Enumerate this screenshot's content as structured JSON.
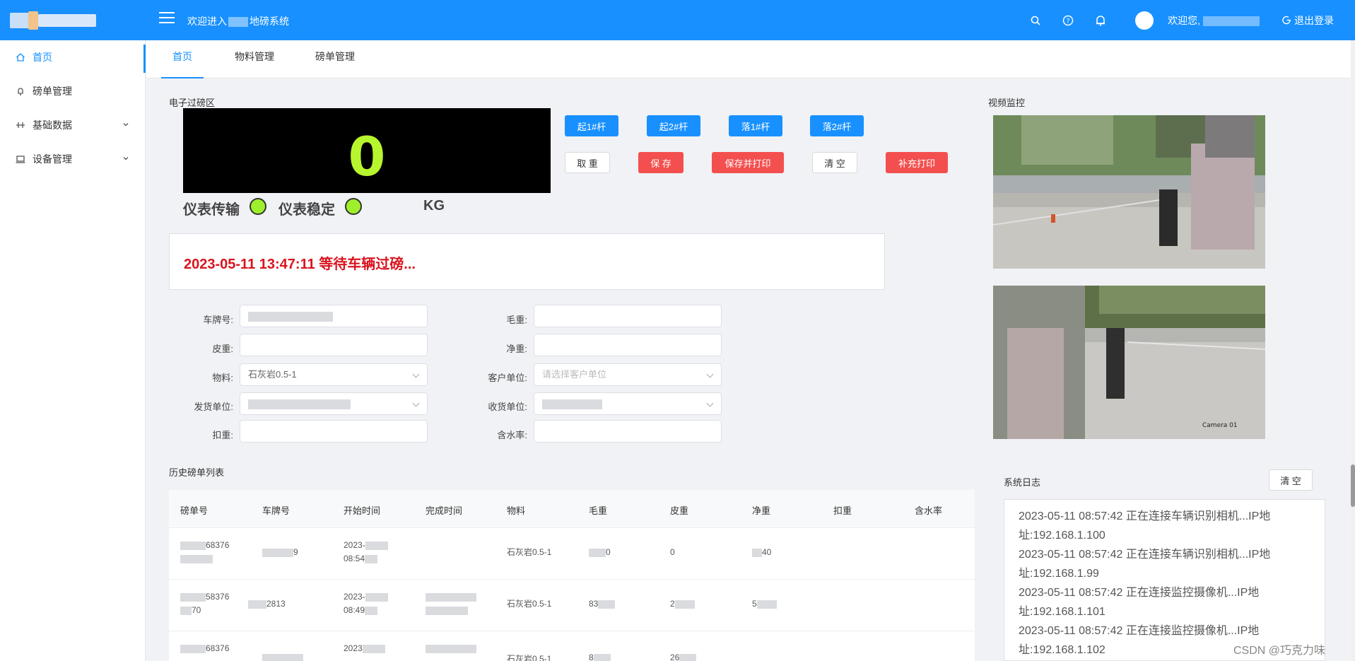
{
  "header": {
    "title_prefix": "欢迎进入",
    "title_suffix": "地磅系统",
    "welcome": "欢迎您,",
    "logout": "退出登录"
  },
  "sidebar": {
    "items": [
      {
        "label": "首页",
        "icon": "home-icon"
      },
      {
        "label": "磅单管理",
        "icon": "bell-icon"
      },
      {
        "label": "基础数据",
        "icon": "sliders-icon"
      },
      {
        "label": "设备管理",
        "icon": "laptop-icon"
      }
    ]
  },
  "tabs": [
    "首页",
    "物料管理",
    "磅单管理"
  ],
  "scale": {
    "section_title": "电子过磅区",
    "weight": "0",
    "indicator1": "仪表传输",
    "indicator2": "仪表稳定",
    "unit": "KG"
  },
  "buttons": {
    "raise1": "起1#杆",
    "raise2": "起2#杆",
    "lower1": "落1#杆",
    "lower2": "落2#杆",
    "cancel": "取 重",
    "save": "保 存",
    "save_print": "保存并打印",
    "clear": "清 空",
    "reprint": "补充打印"
  },
  "status": "2023-05-11 13:47:11 等待车辆过磅...",
  "form": {
    "plate": "车牌号:",
    "gross": "毛重:",
    "tare": "皮重:",
    "net": "净重:",
    "material": "物料:",
    "material_value": "石灰岩0.5-1",
    "customer": "客户单位:",
    "customer_placeholder": "请选择客户单位",
    "shipper": "发货单位:",
    "receiver": "收货单位:",
    "deduct": "扣重:",
    "moisture": "含水率:"
  },
  "history": {
    "title": "历史磅单列表",
    "columns": [
      "磅单号",
      "车牌号",
      "开始时间",
      "完成时间",
      "物料",
      "毛重",
      "皮重",
      "净重",
      "扣重",
      "含水率"
    ],
    "rows": [
      {
        "no": "68376",
        "plate": "9",
        "start_a": "2023-",
        "start_b": "08:54",
        "material": "石灰岩0.5-1",
        "gross": "0",
        "tare": "0",
        "net": "40"
      },
      {
        "no": "58376",
        "no2": "70",
        "plate": "2813",
        "start_a": "2023-",
        "start_b": "08:49",
        "material": "石灰岩0.5-1",
        "gross": "83",
        "tare": "2",
        "net": "5"
      },
      {
        "no": "68376",
        "start_a": "2023",
        "material": "石灰岩0.5-1",
        "gross": "8",
        "tare": "26"
      }
    ]
  },
  "video": {
    "title": "视频监控",
    "cam2_caption": "Camera 01"
  },
  "log": {
    "title": "系统日志",
    "clear": "清 空",
    "lines": [
      "2023-05-11 08:57:42 正在连接车辆识别相机...IP地",
      "址:192.168.1.100",
      "2023-05-11 08:57:42 正在连接车辆识别相机...IP地",
      "址:192.168.1.99",
      "2023-05-11 08:57:42 正在连接监控摄像机...IP地",
      "址:192.168.1.101",
      "2023-05-11 08:57:42 正在连接监控摄像机...IP地",
      "址:192.168.1.102"
    ]
  },
  "watermark": "CSDN @巧克力味",
  "colors": {
    "primary": "#1890ff",
    "danger": "#f44f4f",
    "display_green": "#b7f52e",
    "status_red": "#d9141e"
  }
}
